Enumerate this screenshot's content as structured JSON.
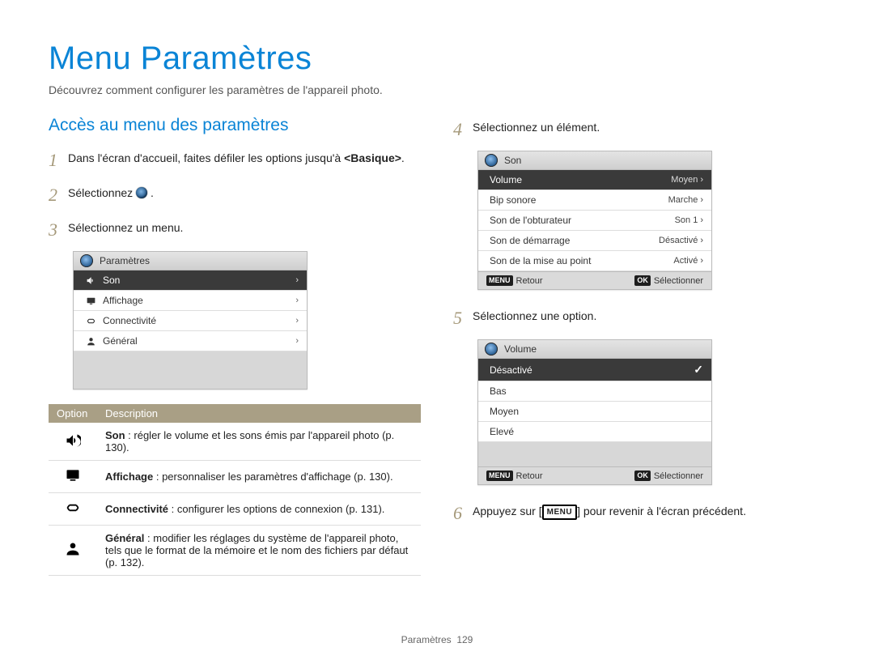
{
  "page": {
    "title": "Menu Paramètres",
    "intro": "Découvrez comment configurer les paramètres de l'appareil photo.",
    "section_heading": "Accès au menu des paramètres",
    "footer_label": "Paramètres",
    "footer_page": "129"
  },
  "steps": {
    "s1_a": "Dans l'écran d'accueil, faites défiler les options jusqu'à ",
    "s1_b": "<Basique>",
    "s1_c": ".",
    "s2": "Sélectionnez ",
    "s2_post": " .",
    "s3": "Sélectionnez un menu.",
    "s4": "Sélectionnez un élément.",
    "s5": "Sélectionnez une option.",
    "s6_a": "Appuyez sur [",
    "s6_menu": "MENU",
    "s6_b": "] pour revenir à l'écran précédent."
  },
  "menu1": {
    "header": "Paramètres",
    "items": [
      "Son",
      "Affichage",
      "Connectivité",
      "Général"
    ]
  },
  "menu2": {
    "header": "Son",
    "rows": [
      {
        "label": "Volume",
        "value": "Moyen"
      },
      {
        "label": "Bip sonore",
        "value": "Marche"
      },
      {
        "label": "Son de l'obturateur",
        "value": "Son 1"
      },
      {
        "label": "Son de démarrage",
        "value": "Désactivé"
      },
      {
        "label": "Son de la mise au point",
        "value": "Activé"
      }
    ]
  },
  "menu3": {
    "header": "Volume",
    "options": [
      "Désactivé",
      "Bas",
      "Moyen",
      "Elevé"
    ],
    "selected_index": 0
  },
  "menu_buttons": {
    "menu_chip": "MENU",
    "back": "Retour",
    "ok_chip": "OK",
    "select": "Sélectionner"
  },
  "options_table": {
    "head_option": "Option",
    "head_desc": "Description",
    "rows": [
      {
        "title": "Son",
        "desc": " : régler le volume et les sons émis par l'appareil photo (p. 130)."
      },
      {
        "title": "Affichage",
        "desc": " : personnaliser les paramètres d'affichage (p. 130)."
      },
      {
        "title": "Connectivité",
        "desc": " : configurer les options de connexion (p. 131)."
      },
      {
        "title": "Général",
        "desc": " : modifier les réglages du système de l'appareil photo, tels que le format de la mémoire et le nom des fichiers par défaut (p. 132)."
      }
    ]
  }
}
